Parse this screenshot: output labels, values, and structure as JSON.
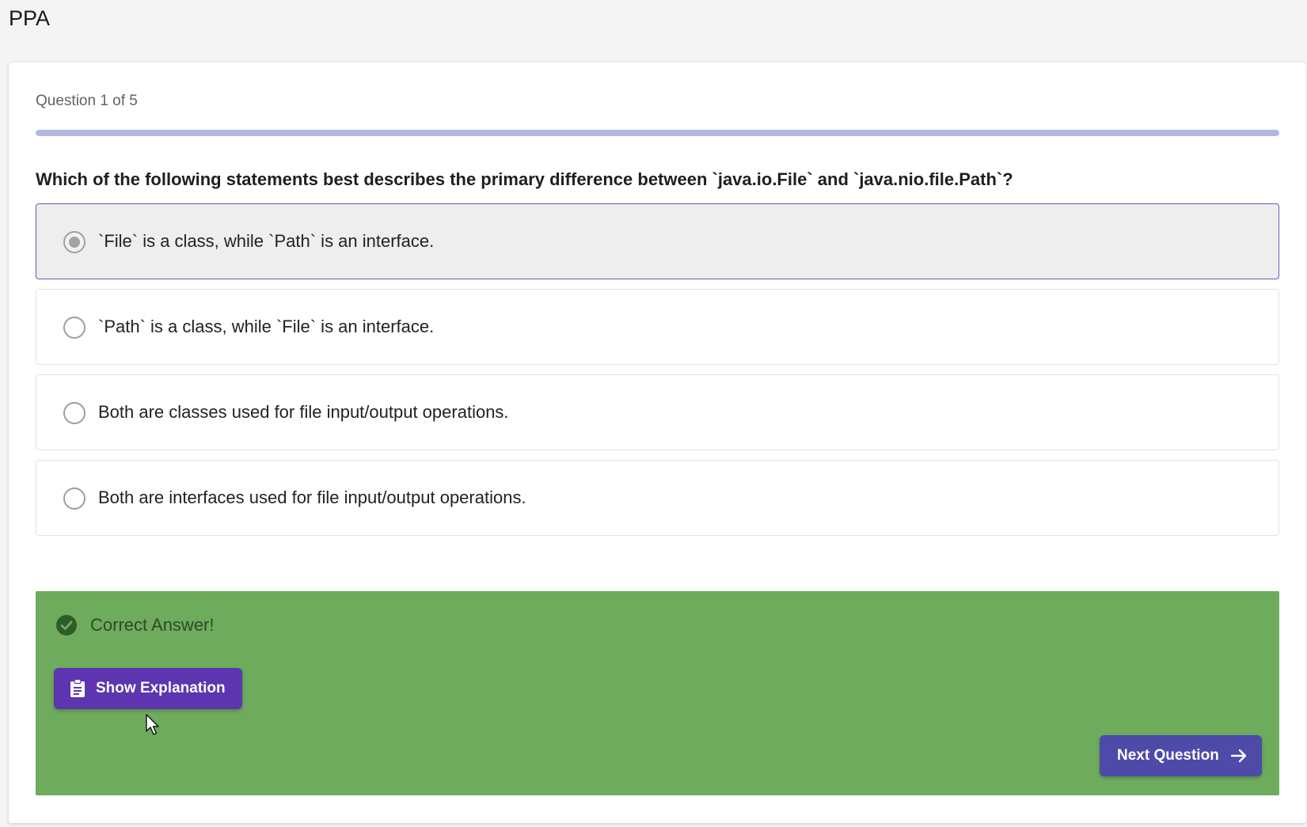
{
  "app": {
    "title": "PPA"
  },
  "progress": {
    "label": "Question 1 of 5",
    "fraction": 1.0
  },
  "question": {
    "text": "Which of the following statements best describes the primary difference between `java.io.File` and `java.nio.file.Path`?"
  },
  "options": [
    {
      "text": "`File` is a class, while `Path` is an interface.",
      "selected": true
    },
    {
      "text": "`Path` is a class, while `File` is an interface.",
      "selected": false
    },
    {
      "text": "Both are classes used for file input/output operations.",
      "selected": false
    },
    {
      "text": "Both are interfaces used for file input/output operations.",
      "selected": false
    }
  ],
  "feedback": {
    "message": "Correct Answer!",
    "status": "correct",
    "icon": "check-circle-icon",
    "color": "#6eab5d"
  },
  "buttons": {
    "show_explanation": {
      "label": "Show Explanation",
      "icon": "clipboard-icon",
      "color": "#5e35b1"
    },
    "next_question": {
      "label": "Next Question",
      "icon": "arrow-right-icon",
      "color": "#4d4aa8"
    }
  },
  "colors": {
    "accent": "#5c5fc4",
    "progress_fill": "#b3b8de"
  }
}
